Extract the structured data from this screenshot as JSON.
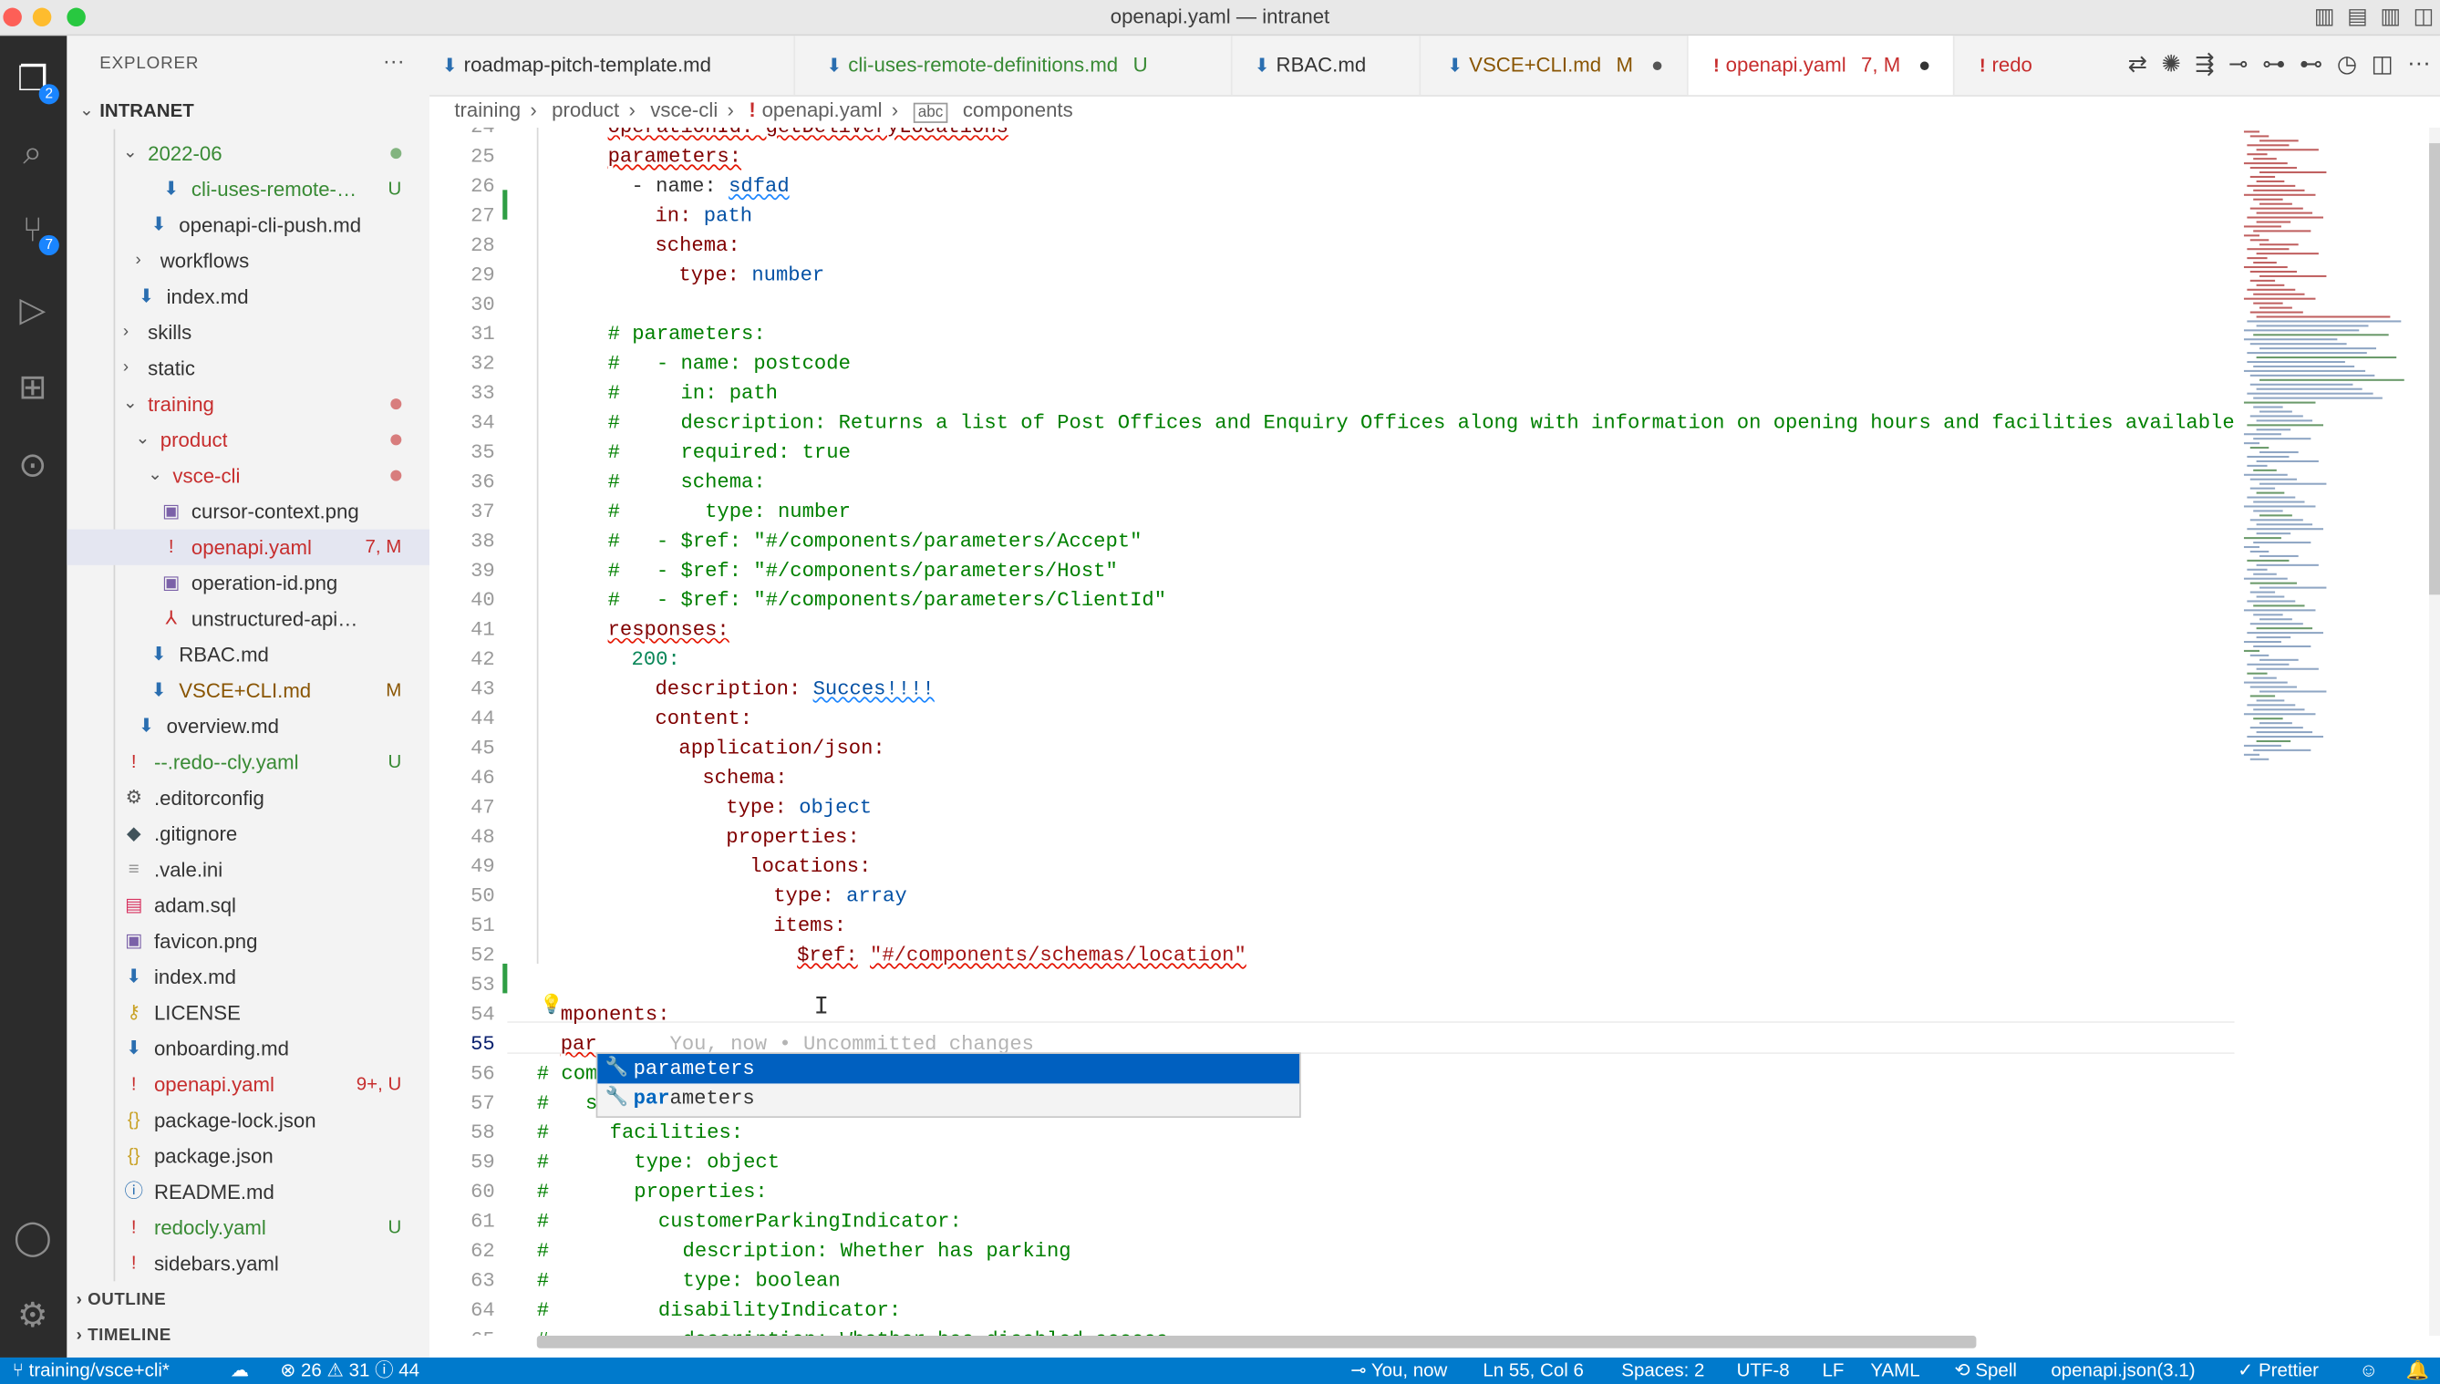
{
  "window": {
    "title": "openapi.yaml — intranet"
  },
  "activity": {
    "explorer_badge": "2",
    "scm_badge": "7"
  },
  "sidebar": {
    "title": "EXPLORER",
    "more": "···",
    "root": "INTRANET",
    "outline": "OUTLINE",
    "timeline": "TIMELINE",
    "rows": [
      {
        "name": "2022-06",
        "status": "",
        "color": "#388a34"
      },
      {
        "name": "cli-uses-remote-def...",
        "status": "U",
        "color": "#388a34"
      },
      {
        "name": "openapi-cli-push.md",
        "status": "",
        "color": "#333333"
      },
      {
        "name": "workflows",
        "status": "",
        "color": "#333333"
      },
      {
        "name": "index.md",
        "status": "",
        "color": "#333333"
      },
      {
        "name": "skills",
        "status": "",
        "color": "#333333"
      },
      {
        "name": "static",
        "status": "",
        "color": "#333333"
      },
      {
        "name": "training",
        "status": "",
        "color": "#c72e2e"
      },
      {
        "name": "product",
        "status": "",
        "color": "#c72e2e"
      },
      {
        "name": "vsce-cli",
        "status": "",
        "color": "#c72e2e"
      },
      {
        "name": "cursor-context.png",
        "status": "",
        "color": "#333333"
      },
      {
        "name": "openapi.yaml",
        "status": "7, M",
        "color": "#c72e2e"
      },
      {
        "name": "operation-id.png",
        "status": "",
        "color": "#333333"
      },
      {
        "name": "unstructured-api-definiti...",
        "status": "",
        "color": "#333333"
      },
      {
        "name": "RBAC.md",
        "status": "",
        "color": "#333333"
      },
      {
        "name": "VSCE+CLI.md",
        "status": "M",
        "color": "#895503"
      },
      {
        "name": "overview.md",
        "status": "",
        "color": "#333333"
      },
      {
        "name": "--.redo--cly.yaml",
        "status": "U",
        "color": "#388a34"
      },
      {
        "name": ".editorconfig",
        "status": "",
        "color": "#333333"
      },
      {
        "name": ".gitignore",
        "status": "",
        "color": "#333333"
      },
      {
        "name": ".vale.ini",
        "status": "",
        "color": "#333333"
      },
      {
        "name": "adam.sql",
        "status": "",
        "color": "#333333"
      },
      {
        "name": "favicon.png",
        "status": "",
        "color": "#333333"
      },
      {
        "name": "index.md",
        "status": "",
        "color": "#333333"
      },
      {
        "name": "LICENSE",
        "status": "",
        "color": "#333333"
      },
      {
        "name": "onboarding.md",
        "status": "",
        "color": "#333333"
      },
      {
        "name": "openapi.yaml",
        "status": "9+, U",
        "color": "#c72e2e"
      },
      {
        "name": "package-lock.json",
        "status": "",
        "color": "#333333"
      },
      {
        "name": "package.json",
        "status": "",
        "color": "#333333"
      },
      {
        "name": "README.md",
        "status": "",
        "color": "#333333"
      },
      {
        "name": "redocly.yaml",
        "status": "U",
        "color": "#388a34"
      },
      {
        "name": "sidebars.yaml",
        "status": "",
        "color": "#333333"
      }
    ]
  },
  "tabs": [
    {
      "label": "roadmap-pitch-template.md",
      "status": ""
    },
    {
      "label": "cli-uses-remote-definitions.md",
      "status": "U"
    },
    {
      "label": "RBAC.md",
      "status": ""
    },
    {
      "label": "VSCE+CLI.md",
      "status": "M"
    },
    {
      "label": "openapi.yaml",
      "status": "7, M"
    },
    {
      "label": "redo",
      "status": ""
    }
  ],
  "breadcrumb": [
    "training",
    "product",
    "vsce-cli",
    "openapi.yaml",
    "components"
  ],
  "editor": {
    "line_numbers": [
      "24",
      "25",
      "26",
      "27",
      "28",
      "29",
      "30",
      "31",
      "32",
      "33",
      "34",
      "35",
      "36",
      "37",
      "38",
      "39",
      "40",
      "41",
      "42",
      "43",
      "44",
      "45",
      "46",
      "47",
      "48",
      "49",
      "50",
      "51",
      "52",
      "53",
      "54",
      "55",
      "56",
      "57",
      "58",
      "59",
      "60",
      "61",
      "62",
      "63",
      "64",
      "65"
    ],
    "l24": "operationId: getDeliveryLocations",
    "l25": "parameters:",
    "l26a": "- name:",
    "l26b": "sdfad",
    "l27a": "in:",
    "l27b": "path",
    "l28": "schema:",
    "l29a": "type:",
    "l29b": "number",
    "l31": "# parameters:",
    "l32": "#   - name: postcode",
    "l33": "#     in: path",
    "l34": "#     description: Returns a list of Post Offices and Enquiry Offices along with information on opening hours and facilities available wit",
    "l35": "#     required: true",
    "l36": "#     schema:",
    "l37": "#       type: number",
    "l38": "#   - $ref: \"#/components/parameters/Accept\"",
    "l39": "#   - $ref: \"#/components/parameters/Host\"",
    "l40": "#   - $ref: \"#/components/parameters/ClientId\"",
    "l41": "responses:",
    "l42": "200:",
    "l43a": "description:",
    "l43b": "Succes!!!!",
    "l44": "content:",
    "l45": "application/json:",
    "l46": "schema:",
    "l47a": "type:",
    "l47b": "object",
    "l48": "properties:",
    "l49": "locations:",
    "l50a": "type:",
    "l50b": "array",
    "l51": "items:",
    "l52a": "$ref:",
    "l52b": "\"#/components/schemas/location\"",
    "l54": "mponents:",
    "l55": "par",
    "l55ghost": "You, now • Uncommitted changes",
    "l56": "# com",
    "l57": "#   s",
    "l58": "#     facilities:",
    "l59": "#       type: object",
    "l60": "#       properties:",
    "l61": "#         customerParkingIndicator:",
    "l62": "#           description: Whether has parking",
    "l63": "#           type: boolean",
    "l64": "#         disabilityIndicator:",
    "l65": "#           description: Whether has disabled access"
  },
  "suggest": {
    "items": [
      {
        "match": "",
        "rest": "parameters"
      },
      {
        "match": "par",
        "rest": "ameters"
      }
    ]
  },
  "status": {
    "branch": "training/vsce+cli*",
    "errors": "26",
    "warnings": "31",
    "info": "44",
    "blame": "You, now",
    "position": "Ln 55, Col 6",
    "spaces": "Spaces: 2",
    "encoding": "UTF-8",
    "eol": "LF",
    "language": "YAML",
    "spell": "Spell",
    "schema": "openapi.json(3.1)",
    "prettier": "Prettier"
  }
}
